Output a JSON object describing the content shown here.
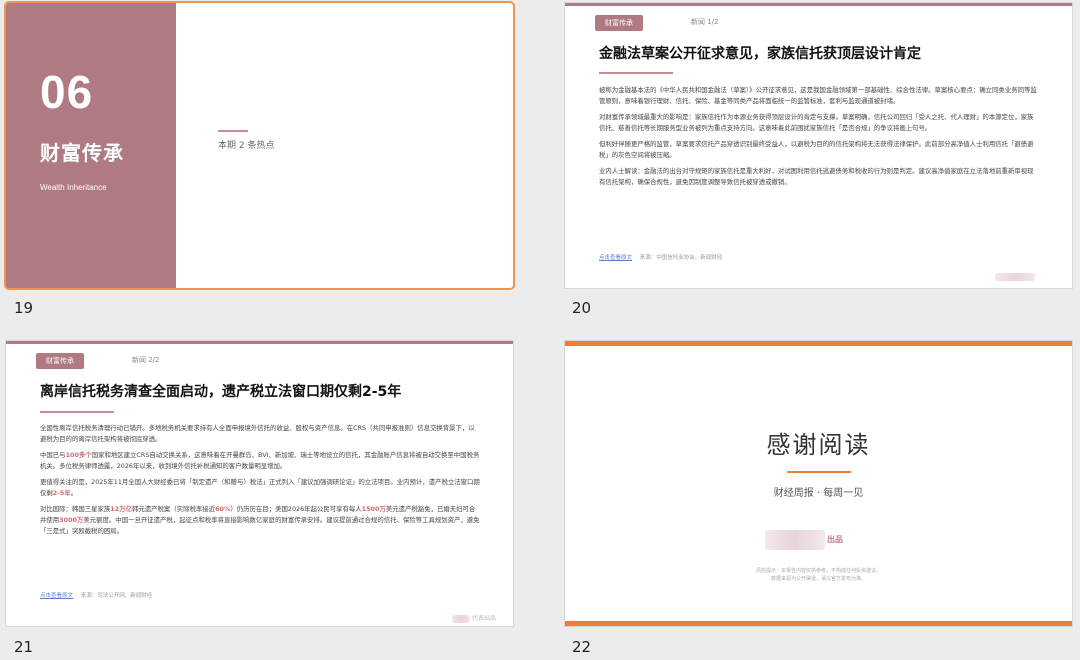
{
  "slides": {
    "s19": {
      "number": "19",
      "section_number": "06",
      "title": "财富传承",
      "subtitle": "Wealth Inheritance",
      "count": "本期 2 条热点"
    },
    "s20": {
      "number": "20",
      "tag": "财富传承",
      "page": "新闻 1/2",
      "headline": "金融法草案公开征求意见，家族信托获顶层设计肯定",
      "paragraphs": [
        "被称为金融基本法的《中华人民共和国金融法（草案）》公开征求意见，这是我国金融领域第一部基础性、综合性法律。草案核心要点：确立同类业务同等监管原则，意味着银行理财、信托、保险、基金等同类产品将面临统一的监管标准，套利与监现通道被封堵。",
        "对财富传承领域最重大的影响是：家族信托作为本源业务获得顶层设计的肯定与支撑。草案明确，信托公司回归「受人之托、代人理财」的本源定位，家族信托、慈善信托等长期服务型业务被列为重点支持方向。这意味着此前困扰家族信托「是否合规」的争议将画上句号。",
        "但利好伴随更严格的监管，草案要求信托产品穿透识别最终受益人，以避税为目的的信托架构将无法获得法律保护。此前部分高净值人士利用信托「避债避税」的灰色空间将被压缩。",
        "业内人士解读：金融法的出台对守规矩的家族信托是重大利好，对试图利用信托逃避债务和税收的行为则是判定。建议高净值家庭在立法落地前重新审视现有信托架构，确保合规性，避免因制度调整导致信托被穿透或撤销。"
      ],
      "source_link": "点击查看原文",
      "source_text": "来源：中国信托业协会、新闻财经"
    },
    "s21": {
      "number": "21",
      "tag": "财富传承",
      "page": "新闻 2/2",
      "headline": "离岸信托税务清查全面启动，遗产税立法窗口期仅剩2-5年",
      "paragraphs": [
        [
          {
            "t": "全国性离岸信托税务清理行动已铺开。多地税务机关要求持有人全面申报境外信托的收益、股权与资产信息。在CRS（共同申报准则）信息交换背景下，以避税为目的的离岸信托架构将被彻底穿透。"
          }
        ],
        [
          {
            "t": "中国已与"
          },
          {
            "t": "100多个",
            "hl": true
          },
          {
            "t": "国家和地区建立CRS自动交换关系，这意味着在开曼群岛、BVI、新加坡、瑞士等地设立的信托，其金融账户信息将被自动交换至中国税务机关。多位税务律师透露，2026年以来，收到境外信托补税通知的客户数量明显增加。"
          }
        ],
        [
          {
            "t": "更值得关注的是，2025年11月全国人大财经委已将「制定遗产（和赠与）税法」正式列入「建议加强调研论证」的立法项目。业内预计，遗产税立法窗口期仅剩"
          },
          {
            "t": "2-5年",
            "hl": true
          },
          {
            "t": "。"
          }
        ],
        [
          {
            "t": "对比国际：韩国三星家族"
          },
          {
            "t": "12万亿",
            "hl": true
          },
          {
            "t": "韩元遗产税案（实际税率接近"
          },
          {
            "t": "60%",
            "hl": true
          },
          {
            "t": "）仍历历在目；美国2026年起公民可享有每人"
          },
          {
            "t": "1500万",
            "hl": true
          },
          {
            "t": "美元遗产税豁免，已婚夫妇可合并使用"
          },
          {
            "t": "3000万",
            "hl": true
          },
          {
            "t": "美元额度。中国一旦开征遗产税，起征点和税率将直接影响数亿家庭的财富传承安排。建议提前通过合规的信托、保险等工具规划资产，避免「三是式」突殴截税的困局。"
          }
        ]
      ],
      "source_link": "点击查看原文",
      "source_text": "来源：司法公开网、新闻财经",
      "watermark": "代表出品"
    },
    "s22": {
      "number": "22",
      "thanks": "感谢阅读",
      "tagline": "财经周报 · 每周一见",
      "brand_suffix": "出品",
      "disclaimer_1": "风险提示：本报告内容仅供参考，不构成任何投资建议。",
      "disclaimer_2": "数据来源为公开渠道，请以官方发布为准。"
    }
  },
  "colors": {
    "accent_rose": "#b07a83",
    "accent_orange": "#f07c3c",
    "selected_border": "#f0964a"
  }
}
